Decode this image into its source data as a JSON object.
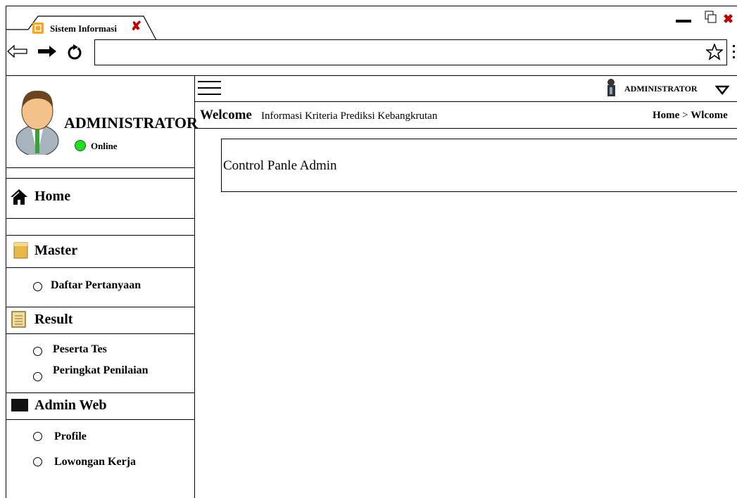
{
  "browser": {
    "tab_title": "Sistem Informasi",
    "tab_close_icon": "close-x-icon",
    "address": ""
  },
  "sidebar": {
    "user_name": "ADMINISTRATOR",
    "status": "Online",
    "status_color": "#22dd22",
    "home_label": "Home",
    "sections": [
      {
        "label": "Master",
        "icon": "folder-icon",
        "items": [
          "Daftar Pertanyaan"
        ]
      },
      {
        "label": "Result",
        "icon": "notepad-icon",
        "items": [
          "Peserta Tes",
          "Peringkat Penilaian"
        ]
      },
      {
        "label": "Admin Web",
        "icon": "monitor-icon",
        "items": [
          "Profile",
          "Lowongan Kerja"
        ]
      }
    ]
  },
  "header": {
    "user_menu": "ADMINISTRATOR",
    "welcome_title": "Welcome",
    "welcome_subtitle": "Informasi Kriteria Prediksi Kebangkrutan",
    "breadcrumb_home": "Home",
    "breadcrumb_sep": ">",
    "breadcrumb_current": "Wlcome"
  },
  "main": {
    "panel_title": "Control Panle Admin"
  },
  "colors": {
    "close_red": "#c00000",
    "online_green": "#22dd22"
  }
}
